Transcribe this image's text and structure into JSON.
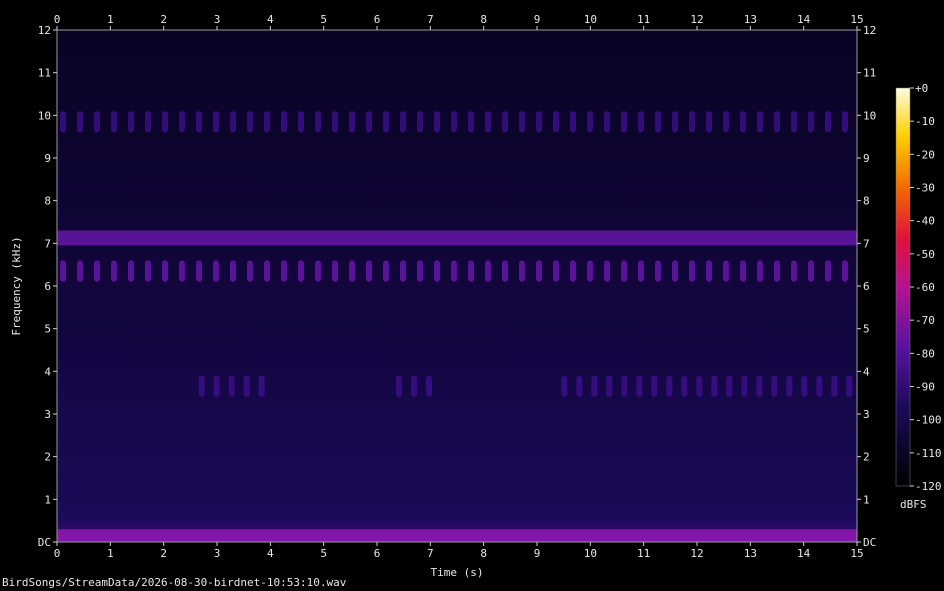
{
  "chart_data": {
    "type": "heatmap",
    "xlabel": "Time (s)",
    "ylabel": "Frequency (kHz)",
    "xlim": [
      0,
      15
    ],
    "ylim": [
      0,
      12
    ],
    "x_ticks": [
      "0",
      "1",
      "2",
      "3",
      "4",
      "5",
      "6",
      "7",
      "8",
      "9",
      "10",
      "11",
      "12",
      "13",
      "14",
      "15"
    ],
    "y_ticks": [
      "DC",
      "1",
      "2",
      "3",
      "4",
      "5",
      "6",
      "7",
      "8",
      "9",
      "10",
      "11",
      "12"
    ],
    "colorbar": {
      "label": "dBFS",
      "range": [
        -120,
        0
      ],
      "ticks": [
        "+0",
        "-10",
        "-20",
        "-30",
        "-40",
        "-50",
        "-60",
        "-70",
        "-80",
        "-90",
        "-100",
        "-110",
        "-120"
      ]
    },
    "bands": [
      {
        "description": "continuous tone",
        "f_low": 6.95,
        "f_high": 7.3,
        "t_start": 0,
        "t_end": 15,
        "level": -75
      },
      {
        "description": "pulsed band",
        "f_low": 6.1,
        "f_high": 6.6,
        "t_start": 0,
        "t_end": 15,
        "level": -82
      },
      {
        "description": "upper pulses",
        "f_low": 9.6,
        "f_high": 10.1,
        "t_start": 0,
        "t_end": 15,
        "level": -95
      },
      {
        "description": "call 3.5 kHz A",
        "f_low": 3.4,
        "f_high": 3.9,
        "t_start": 2.6,
        "t_end": 4.1,
        "level": -85
      },
      {
        "description": "call 3.5 kHz B",
        "f_low": 3.4,
        "f_high": 3.9,
        "t_start": 6.3,
        "t_end": 7.0,
        "level": -85
      },
      {
        "description": "call 3.5 kHz C",
        "f_low": 3.4,
        "f_high": 3.9,
        "t_start": 9.4,
        "t_end": 15,
        "level": -88
      },
      {
        "description": "low rumble",
        "f_low": 0,
        "f_high": 0.3,
        "t_start": 0,
        "t_end": 15,
        "level": -70
      }
    ]
  },
  "footer": {
    "file_path": "BirdSongs/StreamData/2026-08-30-birdnet-10:53:10.wav"
  }
}
